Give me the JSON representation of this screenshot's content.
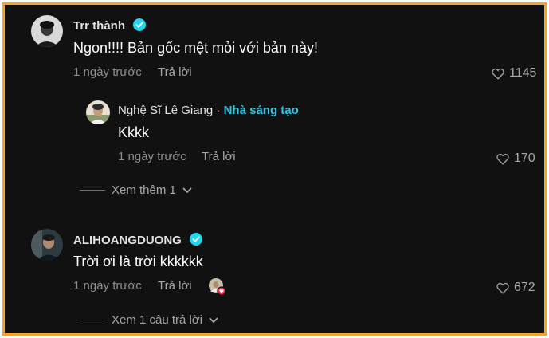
{
  "comments": [
    {
      "username": "Trr thành",
      "text": "Ngon!!!! Bản gốc mệt mỏi với bản này!",
      "time": "1 ngày trước",
      "reply_label": "Trả lời",
      "likes": "1145",
      "replies": [
        {
          "username": "Nghệ Sĩ Lê Giang",
          "separator": "·",
          "badge": "Nhà sáng tạo",
          "text": "Kkkk",
          "time": "1 ngày trước",
          "reply_label": "Trả lời",
          "likes": "170"
        }
      ],
      "more_label": "Xem thêm 1"
    },
    {
      "username": "ALIHOANGDUONG",
      "text": "Trời ơi là trời kkkkkk",
      "time": "1 ngày trước",
      "reply_label": "Trả lời",
      "likes": "672",
      "more_label": "Xem 1 câu trả lời"
    }
  ],
  "colors": {
    "frame": "#f5a623",
    "background": "#111111",
    "verified": "#20d5ec",
    "creator": "#2ec5e6",
    "liked_heart": "#fe2c55"
  }
}
